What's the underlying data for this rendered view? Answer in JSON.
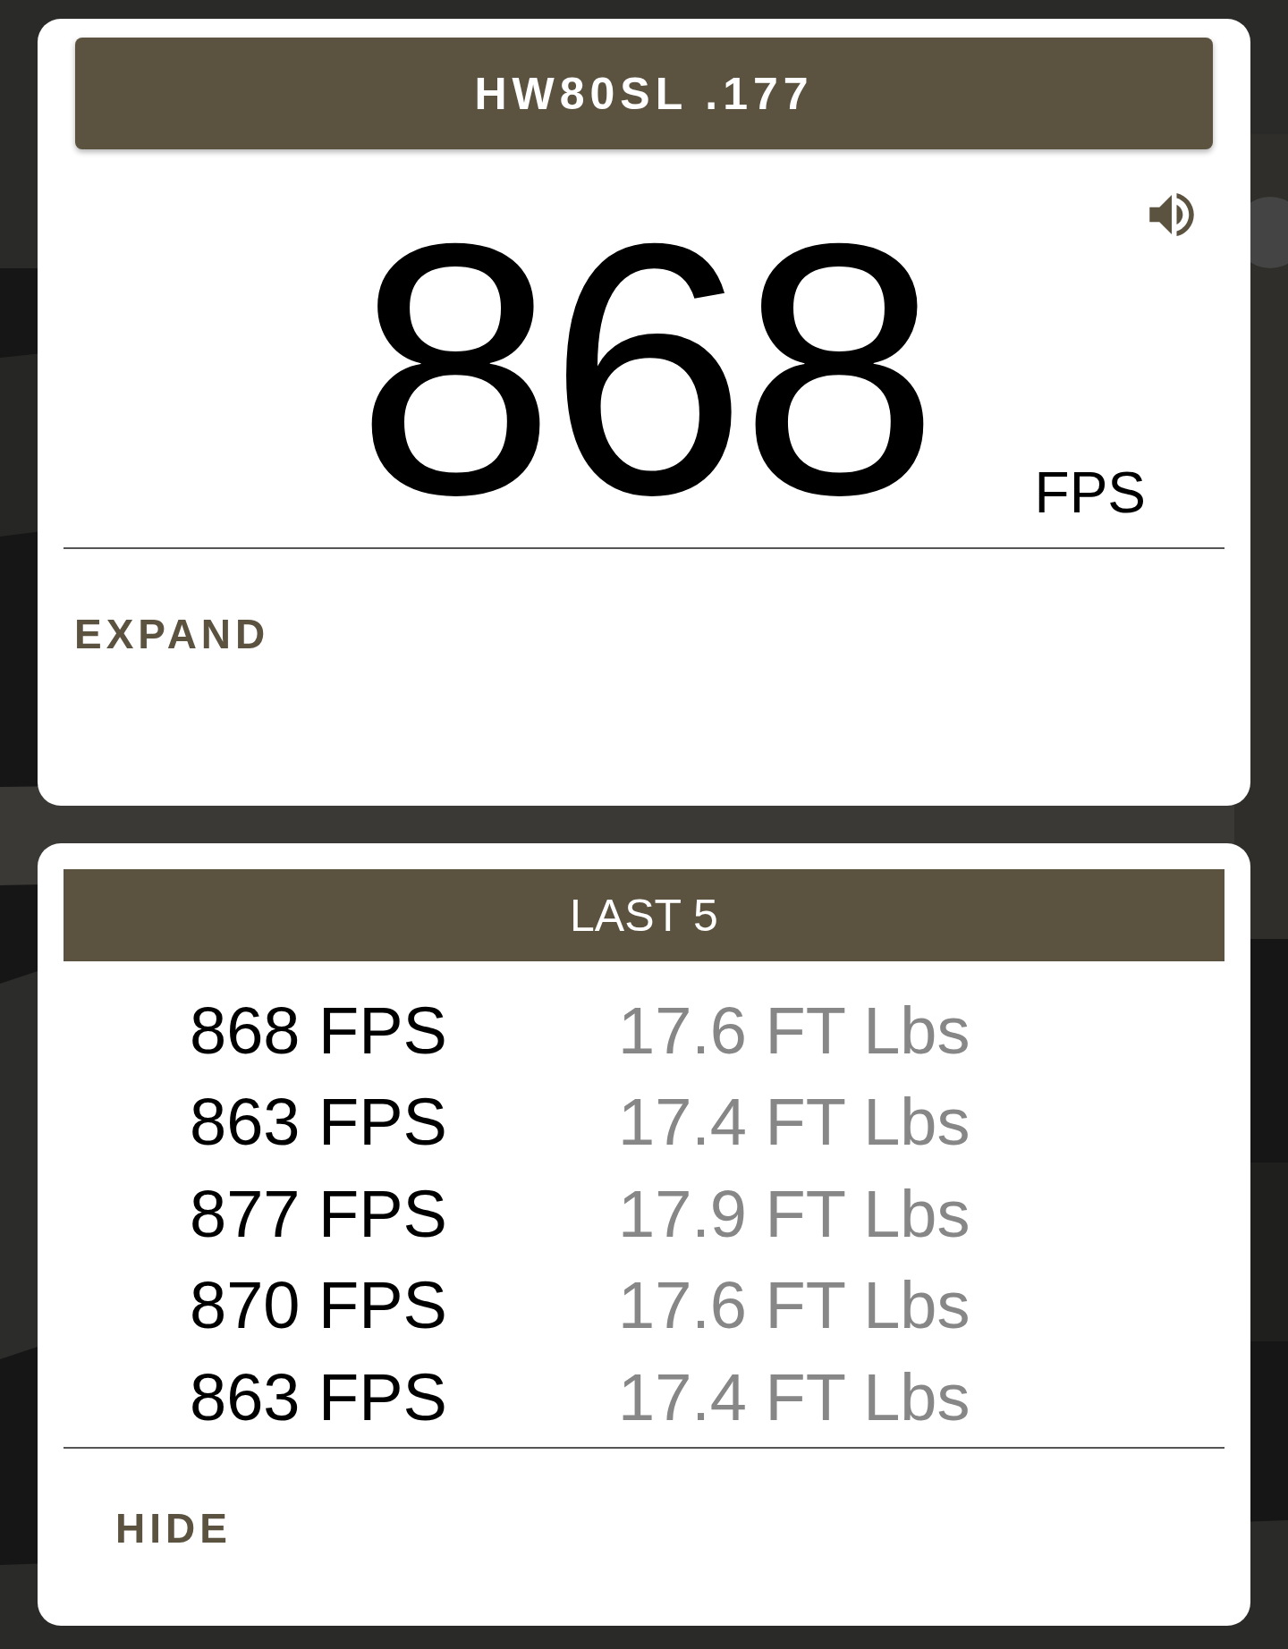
{
  "reading_card": {
    "title": "HW80SL .177",
    "value": "868",
    "unit": "FPS",
    "action": "EXPAND"
  },
  "history_card": {
    "title": "LAST 5",
    "rows": [
      {
        "velocity": "868 FPS",
        "energy": "17.6 FT Lbs"
      },
      {
        "velocity": "863 FPS",
        "energy": "17.4 FT Lbs"
      },
      {
        "velocity": "877 FPS",
        "energy": "17.9 FT Lbs"
      },
      {
        "velocity": "870 FPS",
        "energy": "17.6 FT Lbs"
      },
      {
        "velocity": "863 FPS",
        "energy": "17.4 FT Lbs"
      }
    ],
    "action": "HIDE"
  }
}
